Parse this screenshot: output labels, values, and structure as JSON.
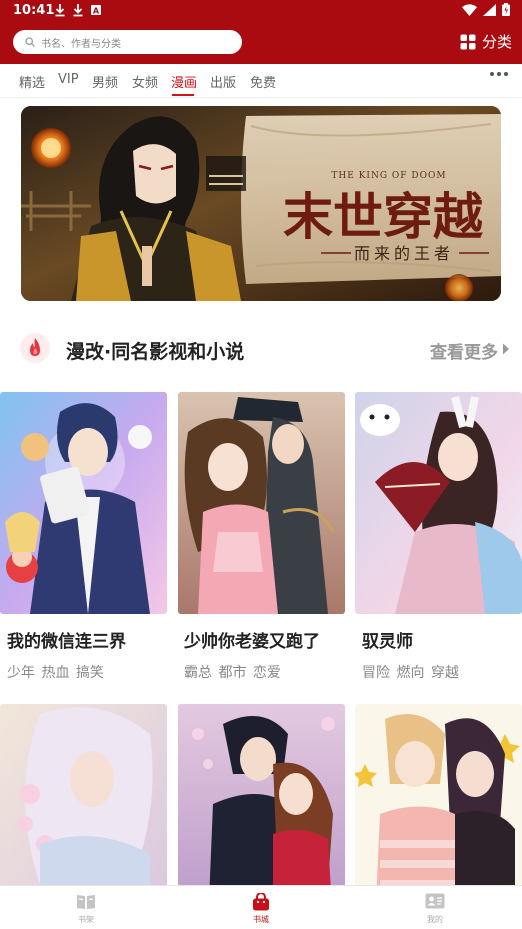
{
  "status": {
    "time": "10:41",
    "download_icon": "download-icon",
    "text_icon": "A"
  },
  "header": {
    "search_placeholder": "书名、作者与分类",
    "category_label": "分类",
    "bg_color": "#a90b10"
  },
  "tabs": [
    {
      "label": "精选",
      "active": false
    },
    {
      "label": "VIP",
      "active": false
    },
    {
      "label": "男频",
      "active": false
    },
    {
      "label": "女频",
      "active": false
    },
    {
      "label": "漫画",
      "active": true
    },
    {
      "label": "出版",
      "active": false
    },
    {
      "label": "免费",
      "active": false
    }
  ],
  "banner": {
    "title": "末世穿越",
    "subtitle": "而来的王者",
    "english": "THE KING OF DOOM"
  },
  "section": {
    "title": "漫改·同名影视和小说",
    "more_label": "查看更多"
  },
  "books": [
    {
      "title": "我的微信连三界",
      "tags": "少年 热血 搞笑"
    },
    {
      "title": "少帅你老婆又跑了",
      "tags": "霸总 都市 恋爱"
    },
    {
      "title": "驭灵师",
      "tags": "冒险 燃向 穿越"
    },
    {
      "title": "",
      "tags": ""
    },
    {
      "title": "",
      "tags": ""
    },
    {
      "title": "",
      "tags": ""
    }
  ],
  "bottom_nav": [
    {
      "label": "书架",
      "icon": "bookshelf-icon",
      "active": false
    },
    {
      "label": "书城",
      "icon": "bookstore-bag-icon",
      "active": true
    },
    {
      "label": "我的",
      "icon": "profile-card-icon",
      "active": false
    }
  ],
  "colors": {
    "accent": "#d0121b",
    "active_nav": "#c9101a"
  }
}
